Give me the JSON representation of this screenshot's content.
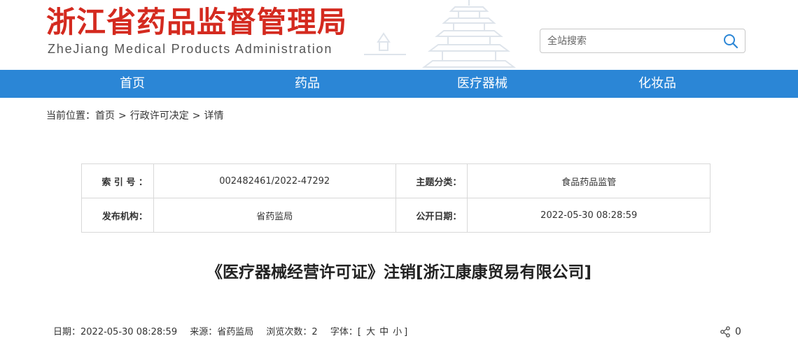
{
  "header": {
    "title_cn": "浙江省药品监督管理局",
    "title_en": "ZheJiang Medical Products Administration",
    "search_placeholder": "全站搜索"
  },
  "nav": {
    "items": [
      {
        "label": "首页"
      },
      {
        "label": "药品"
      },
      {
        "label": "医疗器械"
      },
      {
        "label": "化妆品"
      }
    ]
  },
  "breadcrumb": {
    "prefix": "当前位置：",
    "items": [
      "首页",
      "行政许可决定",
      "详情"
    ],
    "separator": ">"
  },
  "info": {
    "index_label": "索 引 号 ：",
    "index_value": "002482461/2022-47292",
    "category_label": "主题分类：",
    "category_value": "食品药品监管",
    "publisher_label": "发布机构：",
    "publisher_value": "省药监局",
    "date_label": "公开日期：",
    "date_value": "2022-05-30 08:28:59"
  },
  "article": {
    "title": "《医疗器械经营许可证》注销[浙江康康贸易有限公司]"
  },
  "meta": {
    "date_label": "日期：",
    "date_value": "2022-05-30 08:28:59",
    "source_label": "来源：",
    "source_value": "省药监局",
    "views_label": "浏览次数：",
    "views_value": "2",
    "fontsize_label": "字体：",
    "bracket_open": "[",
    "size_large": "大",
    "size_medium": "中",
    "size_small": "小",
    "bracket_close": "]"
  },
  "share": {
    "count": "0"
  },
  "colors": {
    "brand_red": "#d42a1f",
    "nav_blue": "#2b86d6"
  },
  "icons": {
    "search": "search-icon",
    "share": "share-icon"
  }
}
